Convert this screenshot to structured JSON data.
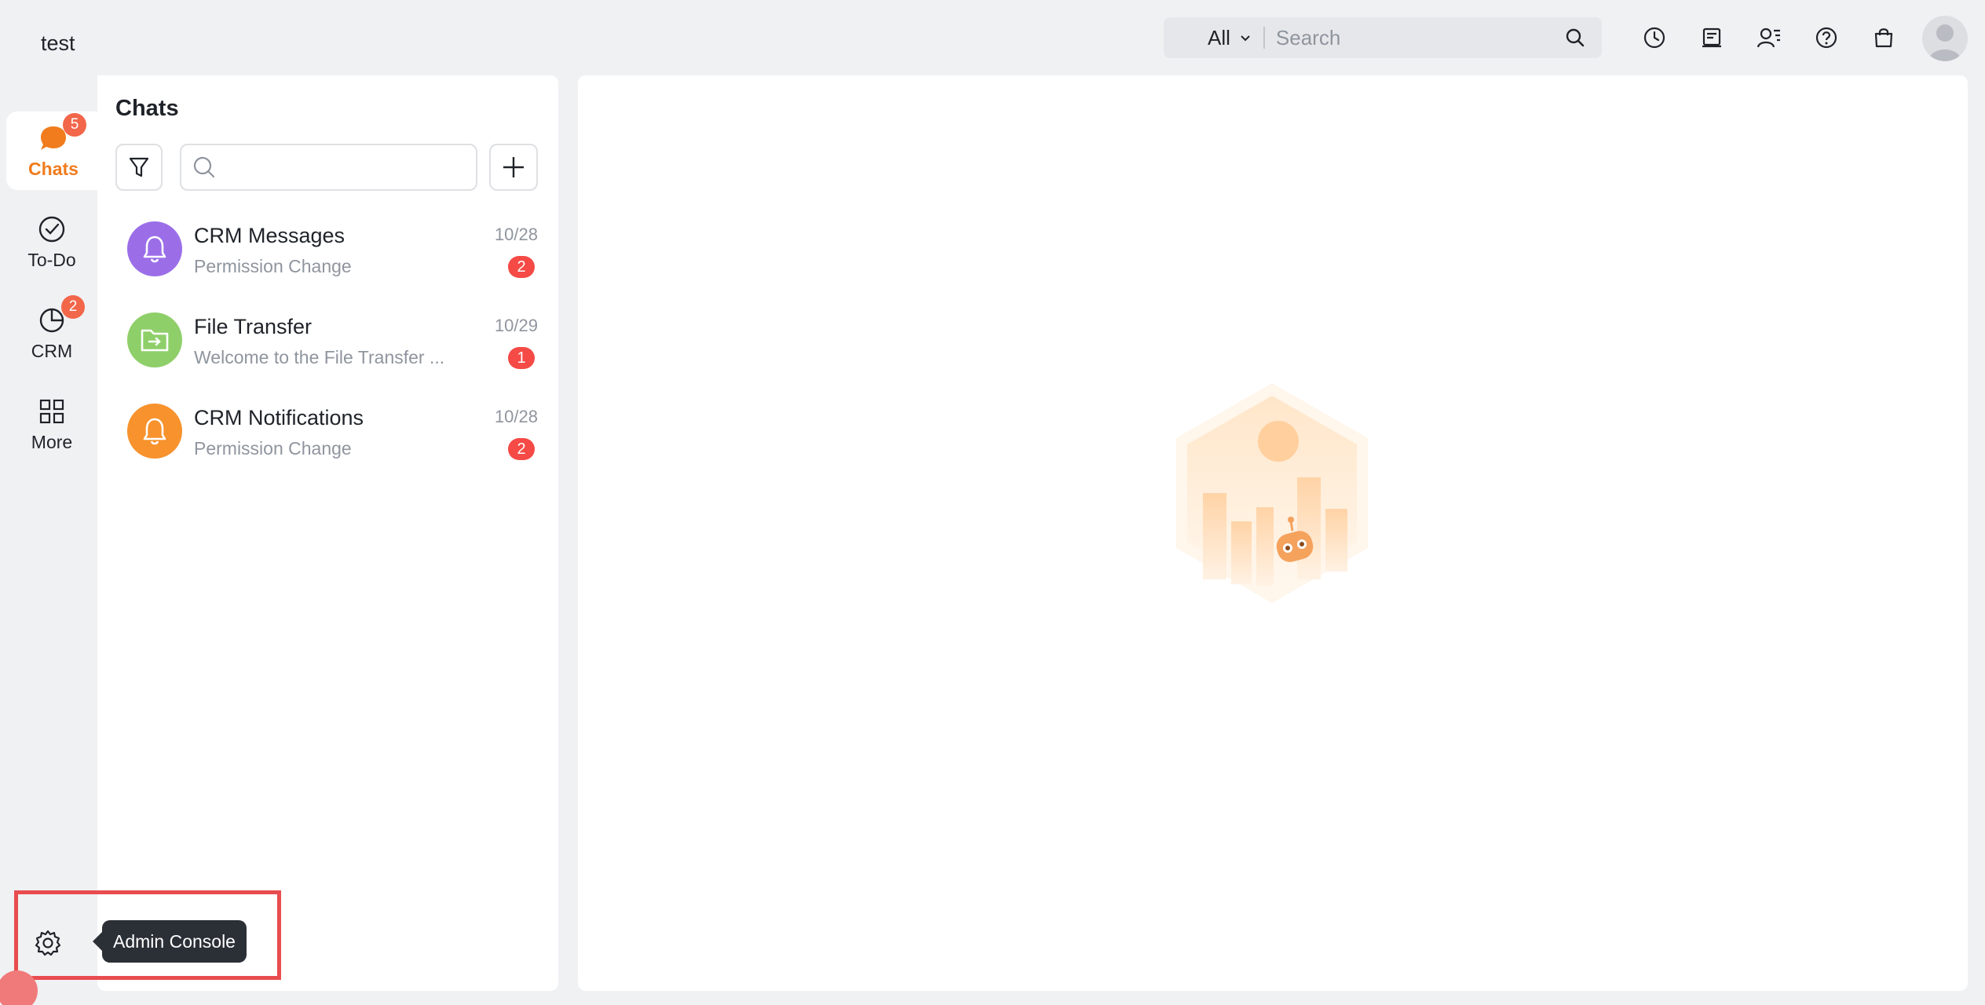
{
  "workspace": {
    "name": "test"
  },
  "topbar": {
    "search_scope": "All",
    "search_placeholder": "Search",
    "icons": [
      "history-icon",
      "notes-icon",
      "contacts-icon",
      "help-icon",
      "store-icon"
    ]
  },
  "nav": {
    "items": [
      {
        "label": "Chats",
        "badge": "5",
        "active": true,
        "icon": "chat-bubble-icon"
      },
      {
        "label": "To-Do",
        "badge": "",
        "active": false,
        "icon": "check-circle-icon"
      },
      {
        "label": "CRM",
        "badge": "2",
        "active": false,
        "icon": "pie-chart-icon"
      },
      {
        "label": "More",
        "badge": "",
        "active": false,
        "icon": "grid-icon"
      }
    ]
  },
  "chats": {
    "title": "Chats",
    "list": [
      {
        "name": "CRM Messages",
        "preview": "Permission Change",
        "date": "10/28",
        "unread": "2",
        "color": "#9b6ee8",
        "icon": "bell-icon"
      },
      {
        "name": "File Transfer",
        "preview": "Welcome to the File Transfer ...",
        "date": "10/29",
        "unread": "1",
        "color": "#8fcf6a",
        "icon": "folder-transfer-icon"
      },
      {
        "name": "CRM Notifications",
        "preview": "Permission Change",
        "date": "10/28",
        "unread": "2",
        "color": "#f7922d",
        "icon": "bell-icon"
      }
    ]
  },
  "admin": {
    "tooltip": "Admin Console"
  },
  "colors": {
    "accent": "#f07c1d",
    "badge": "#f54a45",
    "highlight": "#e84c4f"
  }
}
